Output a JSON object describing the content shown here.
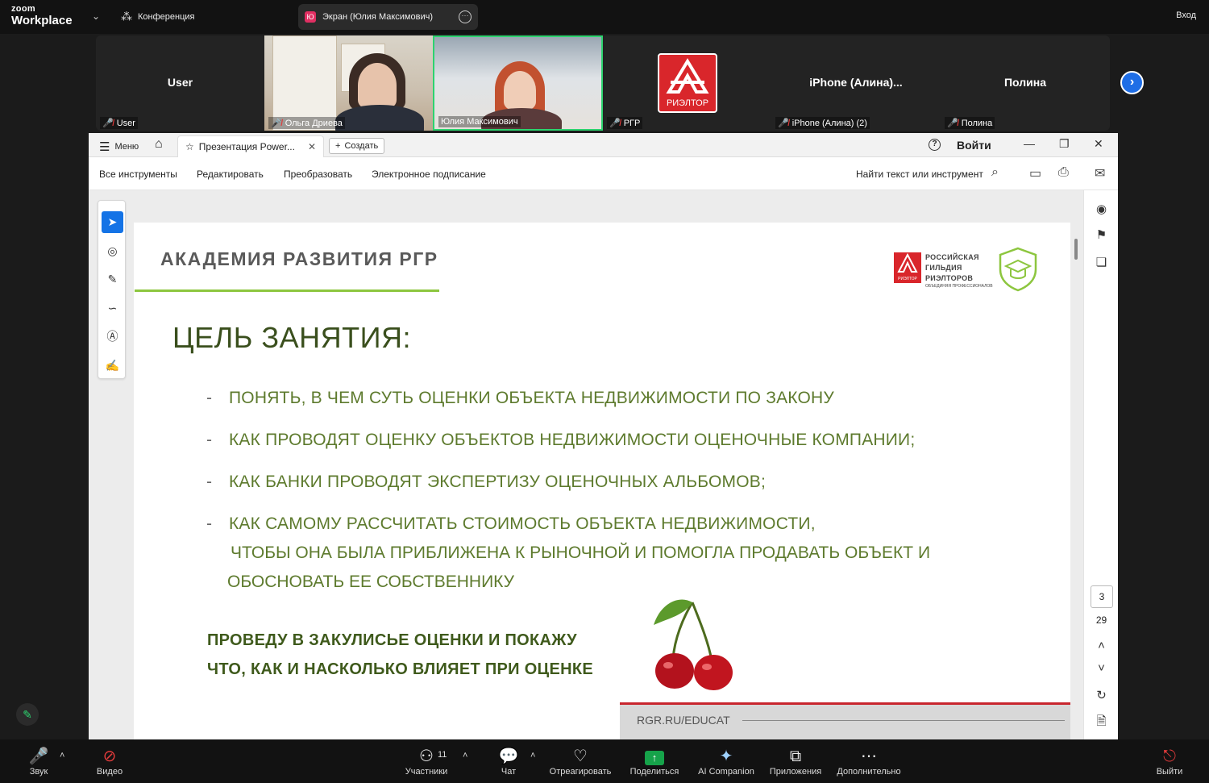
{
  "topbar": {
    "logo_line1": "zoom",
    "logo_line2": "Workplace",
    "meeting_label": "Конференция",
    "share_label": "Экран (Юлия Максимович)",
    "share_badge": "Ю",
    "login": "Вход"
  },
  "participants": [
    {
      "center_name": "User",
      "label": "User"
    },
    {
      "center_name": "",
      "label": "Ольга Дриева"
    },
    {
      "center_name": "",
      "label": "Юлия Максимович"
    },
    {
      "center_name": "",
      "label": "РГР",
      "logo_text": "РИЭЛТОР"
    },
    {
      "center_name": "iPhone  (Алина)...",
      "label": "iPhone (Алина) (2)"
    },
    {
      "center_name": "Полина",
      "label": "Полина"
    }
  ],
  "acrobat": {
    "menu": "Меню",
    "tab_title": "Презентация Power...",
    "create": "Создать",
    "signin": "Войти",
    "toolbar_items": [
      "Все инструменты",
      "Редактировать",
      "Преобразовать",
      "Электронное подписание"
    ],
    "find_label": "Найти текст или инструмент",
    "page_current": "3",
    "page_total": "29"
  },
  "slide": {
    "academy_title": "АКАДЕМИЯ РАЗВИТИЯ РГР",
    "goal_title": "ЦЕЛЬ ЗАНЯТИЯ:",
    "bullets": [
      "ПОНЯТЬ, В ЧЕМ СУТЬ ОЦЕНКИ ОБЪЕКТА НЕДВИЖИМОСТИ ПО ЗАКОНУ",
      "КАК ПРОВОДЯТ ОЦЕНКУ ОБЪЕКТОВ НЕДВИЖИМОСТИ ОЦЕНОЧНЫЕ КОМПАНИИ;",
      "КАК БАНКИ ПРОВОДЯТ ЭКСПЕРТИЗУ ОЦЕНОЧНЫХ АЛЬБОМОВ;",
      "КАК САМОМУ РАССЧИТАТЬ СТОИМОСТЬ ОБЪЕКТА НЕДВИЖИМОСТИ,"
    ],
    "bullet4_cont1": "ЧТОБЫ ОНА БЫЛА ПРИБЛИЖЕНА К РЫНОЧНОЙ И ПОМОГЛА ПРОДАВАТЬ ОБЪЕКТ И",
    "bullet4_cont2": "ОБОСНОВАТЬ ЕЕ СОБСТВЕННИКУ",
    "bold_line1": "ПРОВЕДУ В ЗАКУЛИСЬЕ ОЦЕНКИ И ПОКАЖУ",
    "bold_line2": "ЧТО, КАК И НАСКОЛЬКО ВЛИЯЕТ ПРИ ОЦЕНКЕ",
    "brand_line1": "РОССИЙСКАЯ",
    "brand_line2": "ГИЛЬДИЯ",
    "brand_line3": "РИЭЛТОРОВ",
    "brand_sub": "ОБЪЕДИНЯЯ ПРОФЕССИОНАЛОВ",
    "brand_logo_text": "РИЭЛТОР",
    "footer_url": "RGR.RU/EDUCAT"
  },
  "bottombar": {
    "audio": "Звук",
    "video": "Видео",
    "participants": "Участники",
    "participants_count": "11",
    "chat": "Чат",
    "react": "Отреагировать",
    "share": "Поделиться",
    "ai": "AI Companion",
    "apps": "Приложения",
    "more": "Дополнительно",
    "leave": "Выйти"
  },
  "colors": {
    "accent_blue": "#1473e6",
    "slide_green": "#5d7a2d",
    "brand_red": "#d9262b",
    "share_green": "#16a34a"
  }
}
